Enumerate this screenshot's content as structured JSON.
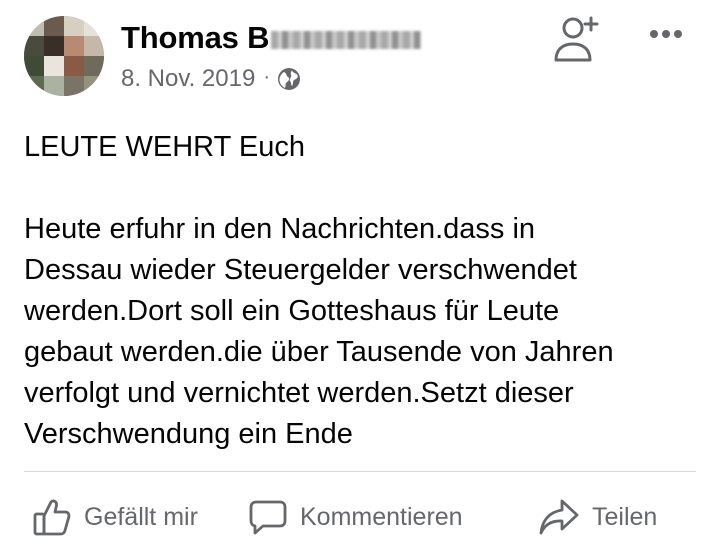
{
  "post": {
    "author": {
      "name_visible": "Thomas B",
      "avatar_icon": "profile-photo-pixelated"
    },
    "date": "8. Nov. 2019",
    "separator": "·",
    "privacy_icon": "globe-icon",
    "headline": "LEUTE WEHRT Euch",
    "text_lines": [
      "Heute erfuhr in den Nachrichten.dass in",
      "Dessau wieder Steuergelder verschwendet",
      "werden.Dort soll ein Gotteshaus für Leute",
      "gebaut werden.die über Tausende von Jahren",
      "verfolgt und vernichtet werden.Setzt dieser",
      "Verschwendung ein Ende"
    ]
  },
  "header_actions": {
    "add_friend_icon": "add-friend-icon",
    "more_icon": "more-options-icon"
  },
  "actions": {
    "like_label": "Gefällt mir",
    "comment_label": "Kommentieren",
    "share_label": "Teilen"
  },
  "colors": {
    "text_primary": "#050505",
    "text_secondary": "#65676b",
    "divider": "#d8dadf"
  }
}
